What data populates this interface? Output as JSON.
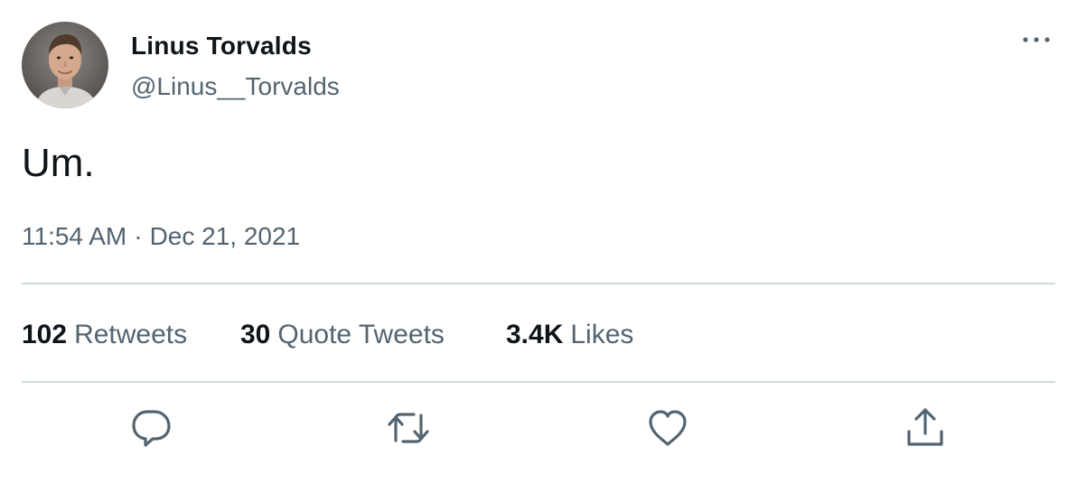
{
  "tweet": {
    "author": {
      "display_name": "Linus Torvalds",
      "handle": "@Linus__Torvalds",
      "avatar_icon": "profile-photo"
    },
    "text": "Um.",
    "time": "11:54 AM",
    "separator": "·",
    "date": "Dec 21, 2021",
    "stats": [
      {
        "count": "102",
        "label": "Retweets"
      },
      {
        "count": "30",
        "label": "Quote Tweets"
      },
      {
        "count": "3.4K",
        "label": "Likes"
      }
    ],
    "actions": [
      {
        "icon": "reply-icon"
      },
      {
        "icon": "retweet-icon"
      },
      {
        "icon": "like-icon"
      },
      {
        "icon": "share-icon"
      }
    ],
    "more_icon": "more-options-icon"
  },
  "colors": {
    "text_primary": "#0f1419",
    "text_secondary": "#536471",
    "divider": "#cfd9de",
    "background": "#ffffff"
  }
}
